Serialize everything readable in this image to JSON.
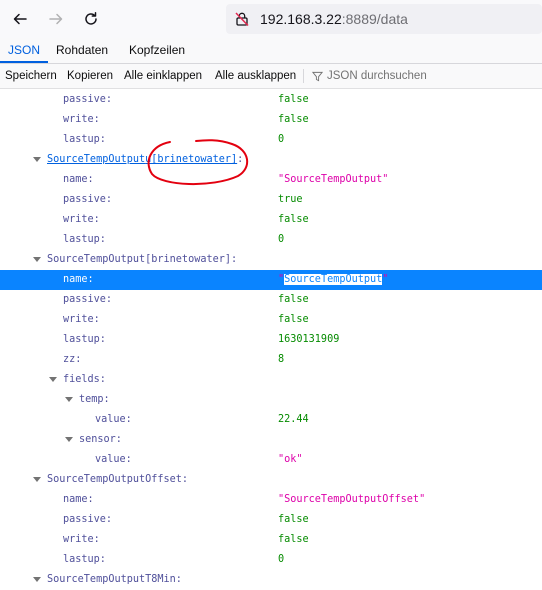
{
  "browser": {
    "url_host": "192.168.3.22",
    "url_rest": ":8889/data"
  },
  "tabs": [
    "JSON",
    "Rohdaten",
    "Kopfzeilen"
  ],
  "json_toolbar": {
    "save": "Speichern",
    "copy": "Kopieren",
    "collapse_all": "Alle einklappen",
    "expand_all": "Alle ausklappen",
    "filter_placeholder": "JSON durchsuchen"
  },
  "rows": [
    {
      "key": "passive:",
      "value": "false",
      "type": "bool"
    },
    {
      "key": "write:",
      "value": "false",
      "type": "bool"
    },
    {
      "key": "lastup:",
      "value": "0",
      "type": "num"
    },
    {
      "key_a": "SourceTempOutput",
      "key_b": "u[brinetowater]",
      "key_c": ":",
      "type": "obj"
    },
    {
      "key": "name:",
      "value": "\"SourceTempOutput\"",
      "type": "str"
    },
    {
      "key": "passive:",
      "value": "true",
      "type": "bool"
    },
    {
      "key": "write:",
      "value": "false",
      "type": "bool"
    },
    {
      "key": "lastup:",
      "value": "0",
      "type": "num"
    },
    {
      "key": "SourceTempOutput[brinetowater]:",
      "type": "obj"
    },
    {
      "key": "name:",
      "value_pre": "\"",
      "value_hl": "SourceTempOutput",
      "value_post": "\"",
      "type": "str"
    },
    {
      "key": "passive:",
      "value": "false",
      "type": "bool"
    },
    {
      "key": "write:",
      "value": "false",
      "type": "bool"
    },
    {
      "key": "lastup:",
      "value": "1630131909",
      "type": "num"
    },
    {
      "key": "zz:",
      "value": "8",
      "type": "num"
    },
    {
      "key": "fields:",
      "type": "obj"
    },
    {
      "key": "temp:",
      "type": "obj"
    },
    {
      "key": "value:",
      "value": "22.44",
      "type": "num"
    },
    {
      "key": "sensor:",
      "type": "obj"
    },
    {
      "key": "value:",
      "value": "\"ok\"",
      "type": "str"
    },
    {
      "key": "SourceTempOutputOffset:",
      "type": "obj"
    },
    {
      "key": "name:",
      "value": "\"SourceTempOutputOffset\"",
      "type": "str"
    },
    {
      "key": "passive:",
      "value": "false",
      "type": "bool"
    },
    {
      "key": "write:",
      "value": "false",
      "type": "bool"
    },
    {
      "key": "lastup:",
      "value": "0",
      "type": "num"
    },
    {
      "key": "SourceTempOutputT8Min:",
      "type": "obj"
    }
  ],
  "colors": {
    "accent": "#0060df",
    "selected_row": "#0a84ff",
    "key": "#4f4f9a",
    "string": "#dd00a9",
    "number_bool": "#058b00",
    "annotation": "#e3000f"
  }
}
